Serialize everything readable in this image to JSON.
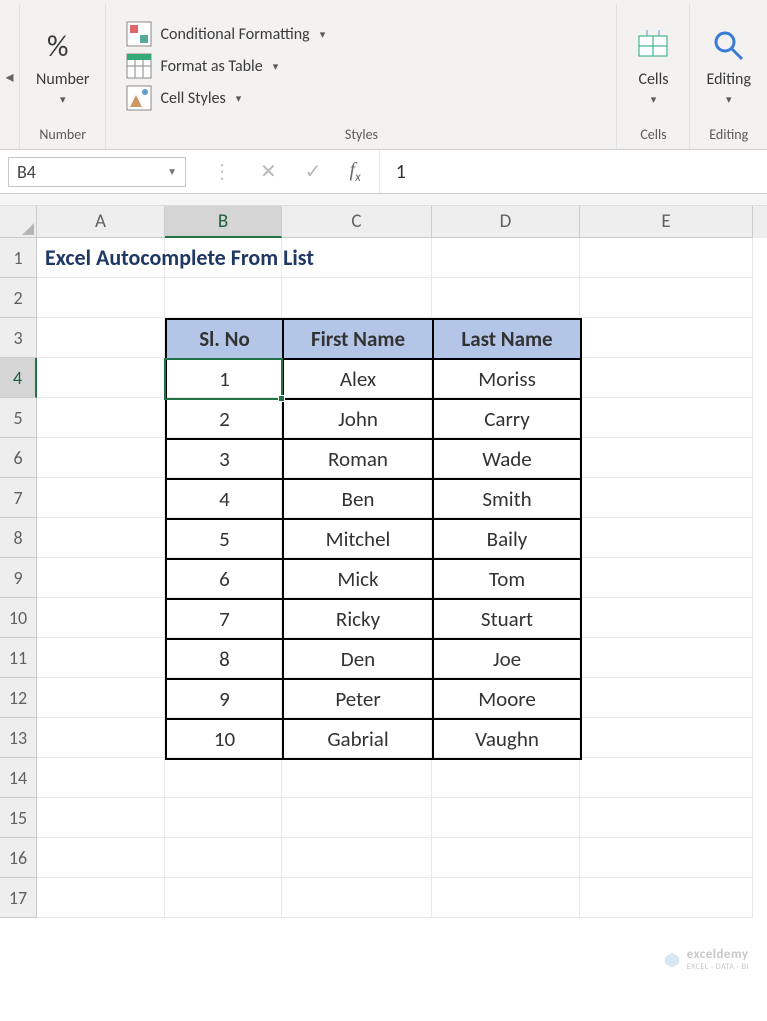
{
  "ribbon": {
    "number_group": {
      "label": "Number",
      "btn": "Number"
    },
    "styles_group": {
      "label": "Styles",
      "conditional": "Conditional Formatting",
      "table": "Format as Table",
      "cellstyles": "Cell Styles"
    },
    "cells_group": {
      "label": "Cells",
      "btn": "Cells"
    },
    "editing_group": {
      "label": "Editing",
      "btn": "Editing"
    }
  },
  "formula_bar": {
    "name_box": "B4",
    "value": "1"
  },
  "columns": [
    "A",
    "B",
    "C",
    "D",
    "E"
  ],
  "row_labels": [
    "1",
    "2",
    "3",
    "4",
    "5",
    "6",
    "7",
    "8",
    "9",
    "10",
    "11",
    "12",
    "13",
    "14",
    "15",
    "16",
    "17"
  ],
  "title": "Excel Autocomplete From List",
  "selected_col_index": 1,
  "selected_row_index": 3,
  "table": {
    "headers": [
      "Sl. No",
      "First Name",
      "Last Name"
    ],
    "rows": [
      [
        "1",
        "Alex",
        "Moriss"
      ],
      [
        "2",
        "John",
        "Carry"
      ],
      [
        "3",
        "Roman",
        "Wade"
      ],
      [
        "4",
        "Ben",
        "Smith"
      ],
      [
        "5",
        "Mitchel",
        "Baily"
      ],
      [
        "6",
        "Mick",
        "Tom"
      ],
      [
        "7",
        "Ricky",
        "Stuart"
      ],
      [
        "8",
        "Den",
        "Joe"
      ],
      [
        "9",
        "Peter",
        "Moore"
      ],
      [
        "10",
        "Gabrial",
        "Vaughn"
      ]
    ]
  },
  "watermark": {
    "brand": "exceldemy",
    "tag": "EXCEL · DATA · BI"
  }
}
